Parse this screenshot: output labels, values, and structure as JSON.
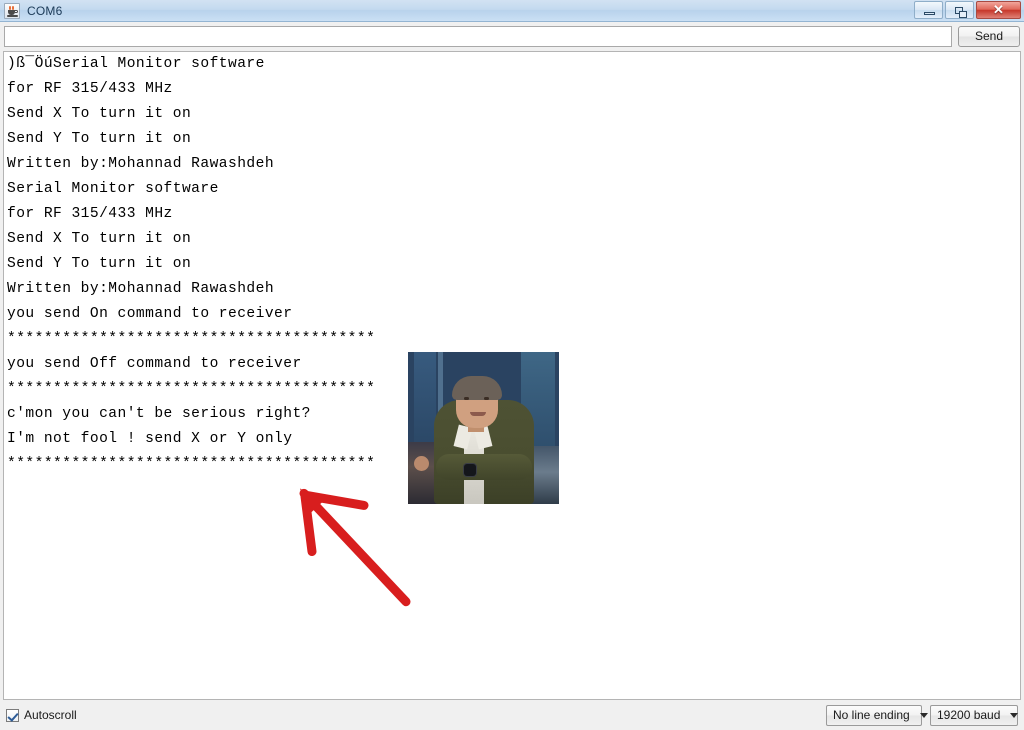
{
  "window": {
    "title": "COM6",
    "app_icon": "java-coffee-cup-icon",
    "controls": {
      "minimize": "minimize-icon",
      "restore": "restore-icon",
      "close_label": "✕"
    }
  },
  "send_bar": {
    "input_value": "",
    "input_placeholder": "",
    "send_label": "Send"
  },
  "console": {
    "lines": [
      ")ß¯ÖúSerial Monitor software",
      "for RF 315/433 MHz",
      "Send X To turn it on",
      "Send Y To turn it on",
      "Written by:Mohannad Rawashdeh",
      "Serial Monitor software",
      "for RF 315/433 MHz",
      "Send X To turn it on",
      "Send Y To turn it on",
      "Written by:Mohannad Rawashdeh",
      "you send On command to receiver",
      "****************************************",
      "you send Off command to receiver",
      "****************************************",
      "c'mon you can't be serious right?",
      "I'm not fool ! send X or Y only",
      "****************************************"
    ],
    "photo_alt": "photo-of-man-with-arms-crossed",
    "annotation_arrow": "red-hand-drawn-arrow"
  },
  "status_bar": {
    "autoscroll_label": "Autoscroll",
    "autoscroll_checked": true,
    "line_ending": "No line ending",
    "baud_rate": "19200 baud"
  },
  "colors": {
    "accent_red": "#d81e1e",
    "titlebar": "#c3d9ef",
    "close_button": "#c6372a",
    "console_bg": "#ffffff",
    "console_text": "#000000"
  }
}
